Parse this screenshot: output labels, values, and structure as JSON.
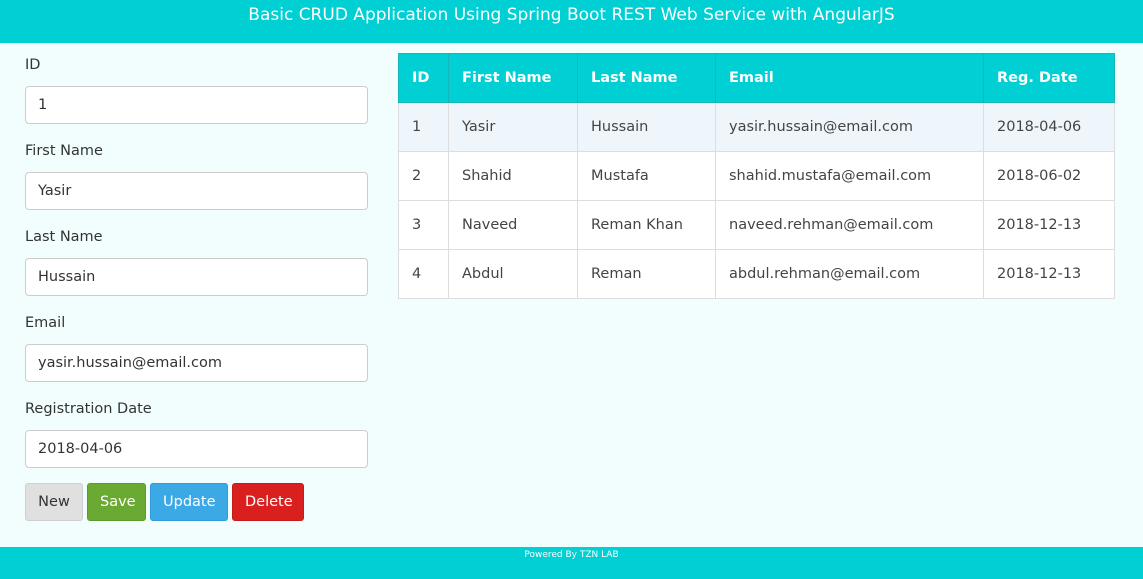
{
  "header": {
    "title": "Basic CRUD Application Using Spring Boot REST Web Service with AngularJS"
  },
  "form": {
    "id_label": "ID",
    "id_value": "1",
    "first_name_label": "First Name",
    "first_name_value": "Yasir",
    "last_name_label": "Last Name",
    "last_name_value": "Hussain",
    "email_label": "Email",
    "email_value": "yasir.hussain@email.com",
    "reg_date_label": "Registration Date",
    "reg_date_value": "2018-04-06"
  },
  "buttons": {
    "new": "New",
    "save": "Save",
    "update": "Update",
    "delete": "Delete"
  },
  "table": {
    "columns": [
      "ID",
      "First Name",
      "Last Name",
      "Email",
      "Reg. Date"
    ],
    "rows": [
      [
        "1",
        "Yasir",
        "Hussain",
        "yasir.hussain@email.com",
        "2018-04-06"
      ],
      [
        "2",
        "Shahid",
        "Mustafa",
        "shahid.mustafa@email.com",
        "2018-06-02"
      ],
      [
        "3",
        "Naveed",
        "Reman Khan",
        "naveed.rehman@email.com",
        "2018-12-13"
      ],
      [
        "4",
        "Abdul",
        "Reman",
        "abdul.rehman@email.com",
        "2018-12-13"
      ]
    ]
  },
  "footer": {
    "text": "Powered By TZN LAB"
  },
  "colors": {
    "accent": "#00cfd3",
    "background": "#f2fefe",
    "save": "#6aaa32",
    "update": "#3ba9e6",
    "delete": "#d9201f"
  }
}
